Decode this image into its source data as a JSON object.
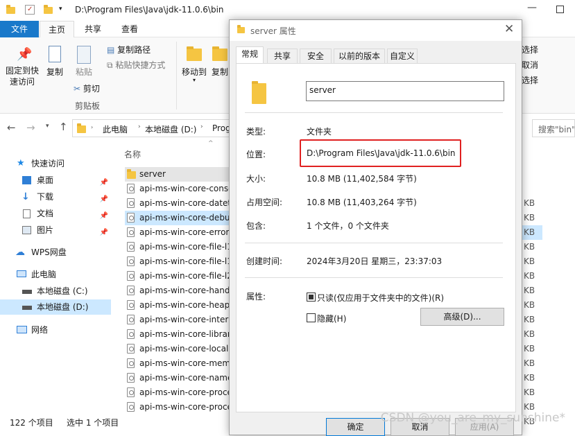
{
  "explorer": {
    "window_title": "D:\\Program Files\\Java\\jdk-11.0.6\\bin",
    "tabs": [
      "文件",
      "主页",
      "共享",
      "查看"
    ],
    "ribbon": {
      "pin_label": "固定到快\n速访问",
      "copy_label": "复制",
      "paste_label": "粘贴",
      "copy_path_label": "复制路径",
      "paste_shortcut_label": "粘贴快捷方式",
      "cut_label": "剪切",
      "clipboard_group": "剪贴板",
      "move_to_label": "移动到",
      "copy_to_label": "复制",
      "right_items": [
        "选择",
        "取消",
        "选择"
      ]
    },
    "address": {
      "crumbs": [
        "此电脑",
        "本地磁盘 (D:)",
        "Prog"
      ],
      "search_placeholder": "搜索\"bin\""
    },
    "nav": [
      {
        "label": "快速访问",
        "icon": "star-icon"
      },
      {
        "label": "桌面",
        "icon": "desktop-icon",
        "pinned": true
      },
      {
        "label": "下载",
        "icon": "download-icon",
        "pinned": true
      },
      {
        "label": "文档",
        "icon": "document-icon",
        "pinned": true
      },
      {
        "label": "图片",
        "icon": "picture-icon",
        "pinned": true
      },
      {
        "label": "WPS网盘",
        "icon": "cloud-icon"
      },
      {
        "label": "此电脑",
        "icon": "computer-icon"
      },
      {
        "label": "本地磁盘 (C:)",
        "icon": "drive-icon"
      },
      {
        "label": "本地磁盘 (D:)",
        "icon": "drive-icon"
      },
      {
        "label": "网络",
        "icon": "network-icon"
      }
    ],
    "column_header": "名称",
    "files": [
      "server",
      "api-ms-win-core-conso",
      "api-ms-win-core-datet",
      "api-ms-win-core-debu",
      "api-ms-win-core-error",
      "api-ms-win-core-file-l1",
      "api-ms-win-core-file-l1",
      "api-ms-win-core-file-l2",
      "api-ms-win-core-hand",
      "api-ms-win-core-heap",
      "api-ms-win-core-interl",
      "api-ms-win-core-librar",
      "api-ms-win-core-locali",
      "api-ms-win-core-mem",
      "api-ms-win-core-name",
      "api-ms-win-core-proce",
      "api-ms-win-core-proce"
    ],
    "size_unit": "KB",
    "status": {
      "count": "122 个项目",
      "selected": "选中 1 个项目"
    }
  },
  "dialog": {
    "title": "server 属性",
    "tabs": [
      "常规",
      "共享",
      "安全",
      "以前的版本",
      "自定义"
    ],
    "name": "server",
    "type_label": "类型:",
    "type_value": "文件夹",
    "location_label": "位置:",
    "location_value": "D:\\Program Files\\Java\\jdk-11.0.6\\bin",
    "size_label": "大小:",
    "size_value": "10.8 MB (11,402,584 字节)",
    "disk_label": "占用空间:",
    "disk_value": "10.8 MB (11,403,264 字节)",
    "contains_label": "包含:",
    "contains_value": "1 个文件，0 个文件夹",
    "created_label": "创建时间:",
    "created_value": "2024年3月20日 星期三，23:37:03",
    "attr_label": "属性:",
    "readonly_label": "只读(仅应用于文件夹中的文件)(R)",
    "hidden_label": "隐藏(H)",
    "advanced_label": "高级(D)...",
    "ok_label": "确定",
    "cancel_label": "取消",
    "apply_label": "应用(A)",
    "highlight_color": "#e02020"
  },
  "watermark": "CSDN @you_are_my_sunshine*"
}
